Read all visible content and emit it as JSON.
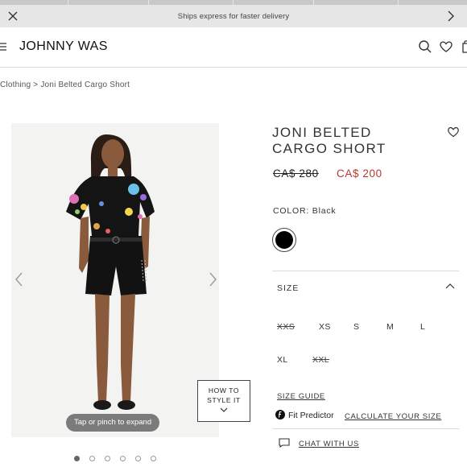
{
  "announcement": {
    "text": "Ships express for faster delivery"
  },
  "header": {
    "logo": "JOHNNY WAS"
  },
  "breadcrumb": {
    "parent": "Clothing",
    "separator": ">",
    "current": "Joni Belted Cargo Short"
  },
  "gallery": {
    "overlay_hint": "Tap or pinch to expand",
    "style_it_line1": "HOW TO",
    "style_it_line2": "STYLE IT",
    "dot_count": 6,
    "active_dot": 1
  },
  "product": {
    "title_line1": "JONI BELTED",
    "title_line2": "CARGO SHORT",
    "price_original": "CA$ 280",
    "price_sale": "CA$ 200",
    "color_label": "COLOR:",
    "color_value": "Black",
    "swatch_color": "#000000",
    "sale_color": "#b53a2e"
  },
  "size": {
    "label": "SIZE",
    "options": [
      {
        "label": "XXS",
        "available": false
      },
      {
        "label": "XS",
        "available": true
      },
      {
        "label": "S",
        "available": true
      },
      {
        "label": "M",
        "available": true
      },
      {
        "label": "L",
        "available": true
      },
      {
        "label": "XL",
        "available": true
      },
      {
        "label": "XXL",
        "available": false
      }
    ],
    "guide_link": "SIZE GUIDE"
  },
  "fit": {
    "label": "Fit Predictor",
    "link": "CALCULATE YOUR SIZE"
  },
  "chat": {
    "link": "CHAT WITH US"
  }
}
